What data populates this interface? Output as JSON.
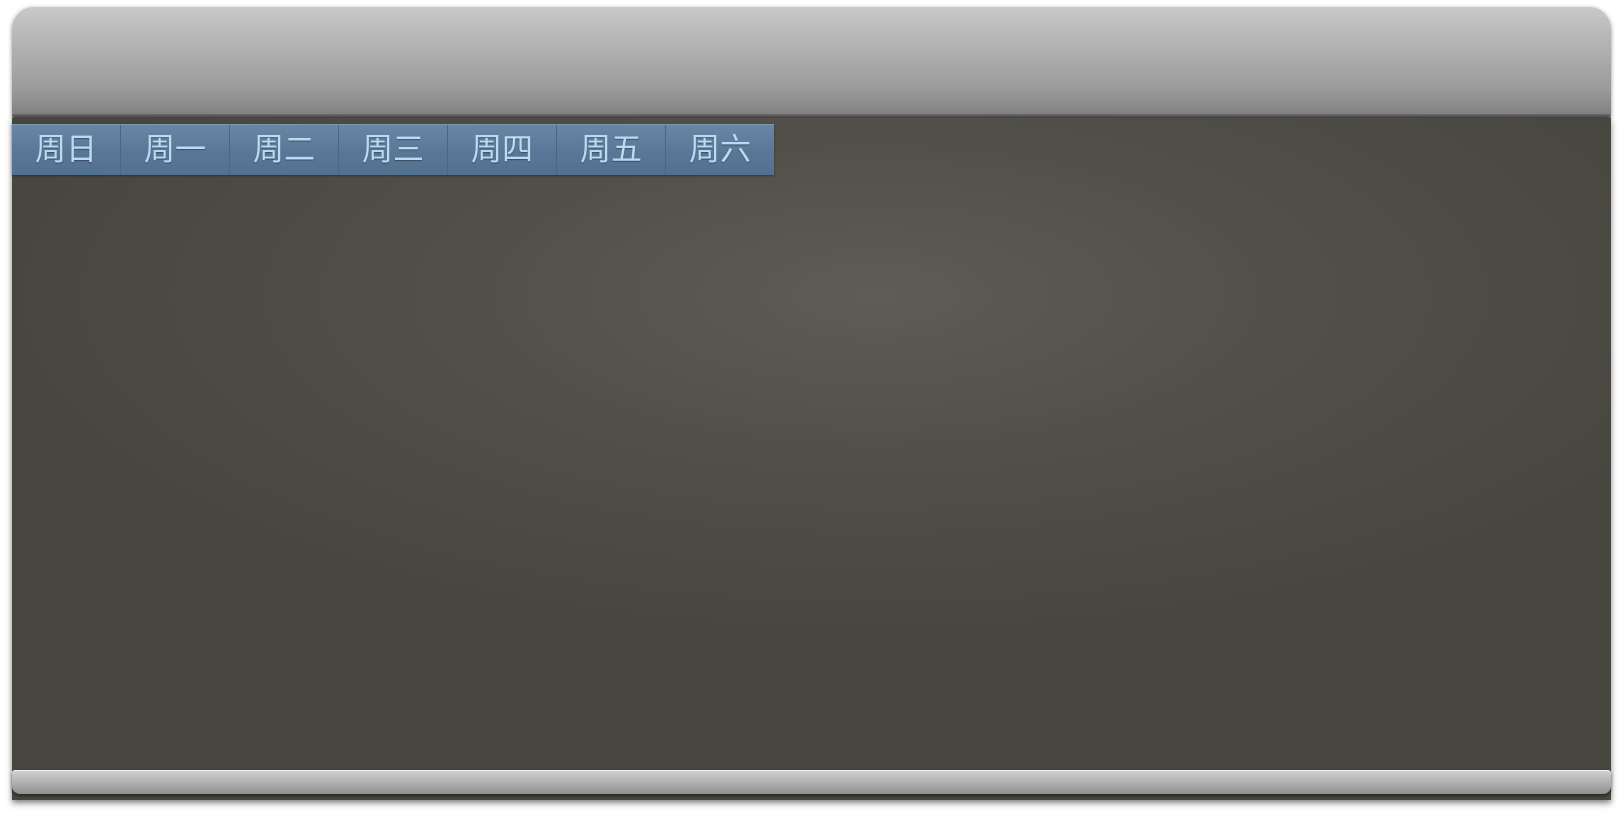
{
  "days": {
    "tabs": [
      {
        "label": "周日"
      },
      {
        "label": "周一"
      },
      {
        "label": "周二"
      },
      {
        "label": "周三"
      },
      {
        "label": "周四"
      },
      {
        "label": "周五"
      },
      {
        "label": "周六"
      }
    ]
  },
  "colors": {
    "top_bar": "#b3b3b3",
    "panel_background": "#525049",
    "tab_background": "#5b7797",
    "tab_text": "#b8dcf2",
    "bottom_bar": "#b5b5b5"
  }
}
